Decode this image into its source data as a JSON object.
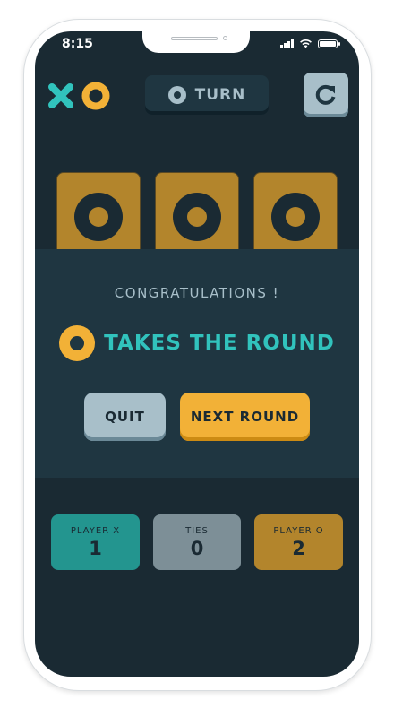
{
  "status_bar": {
    "time": "8:15"
  },
  "header": {
    "logo": {
      "x_icon": "x-mark-icon",
      "o_icon": "o-mark-icon",
      "x_color": "#31c3bd",
      "o_color": "#f2b137"
    },
    "turn_label": "TURN",
    "turn_icon": "o-mark-icon",
    "restart_icon": "restart-icon"
  },
  "board": {
    "visible_tiles": [
      "O",
      "O",
      "O"
    ]
  },
  "modal": {
    "congrats": "CONGRATULATIONS !",
    "winner_icon": "o-mark-icon",
    "winner_text": "TAKES THE ROUND",
    "quit_label": "QUIT",
    "next_label": "NEXT ROUND"
  },
  "scores": {
    "x": {
      "label": "PLAYER X",
      "value": "1"
    },
    "ties": {
      "label": "TIES",
      "value": "0"
    },
    "o": {
      "label": "PLAYER O",
      "value": "2"
    }
  },
  "colors": {
    "background": "#1a2a33",
    "panel": "#1f3641",
    "teal": "#31c3bd",
    "yellow": "#f2b137",
    "silver": "#a8bfc9"
  }
}
